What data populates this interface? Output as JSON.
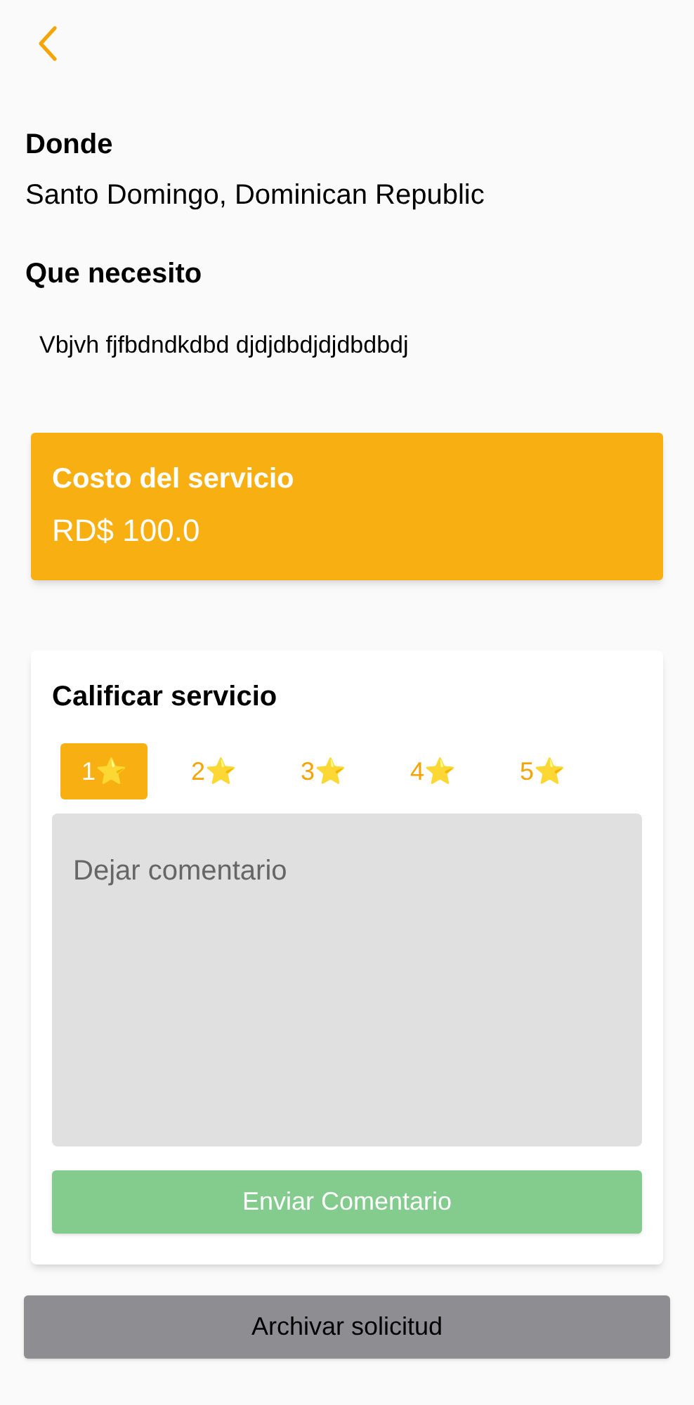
{
  "where": {
    "label": "Donde",
    "value": "Santo Domingo, Dominican Republic"
  },
  "need": {
    "label": "Que necesito",
    "value": "Vbjvh fjfbdndkdbd djdjdbdjdjdbdbdj"
  },
  "cost": {
    "label": "Costo del servicio",
    "value": "RD$ 100.0"
  },
  "rating": {
    "title": "Calificar servicio",
    "options": [
      {
        "label": "1⭐",
        "selected": true
      },
      {
        "label": "2⭐",
        "selected": false
      },
      {
        "label": "3⭐",
        "selected": false
      },
      {
        "label": "4⭐",
        "selected": false
      },
      {
        "label": "5⭐",
        "selected": false
      }
    ],
    "comment": {
      "placeholder": "Dejar comentario"
    },
    "submit": {
      "label": "Enviar Comentario",
      "disabled": true
    }
  },
  "archive": {
    "label": "Archivar solicitud"
  }
}
